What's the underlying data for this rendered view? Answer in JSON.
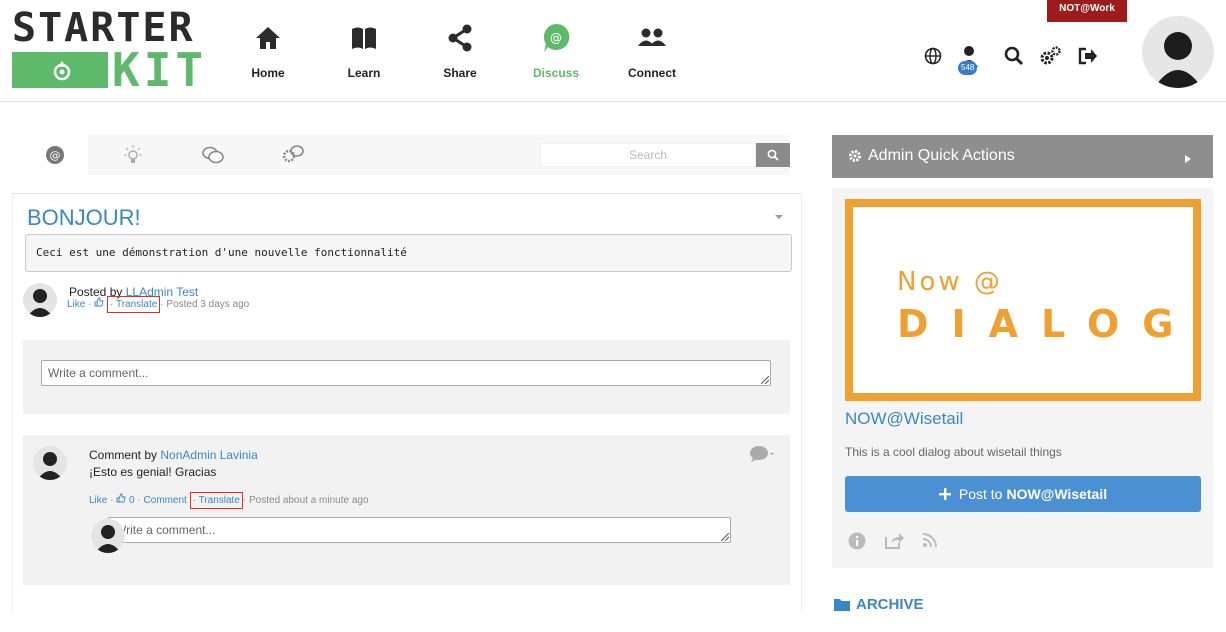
{
  "logo": {
    "line1": "STARTER",
    "line2": "KIT"
  },
  "nav": [
    {
      "label": "Home",
      "icon": "home-icon"
    },
    {
      "label": "Learn",
      "icon": "book-icon"
    },
    {
      "label": "Share",
      "icon": "share-icon"
    },
    {
      "label": "Discuss",
      "icon": "at-chat-icon",
      "active": true
    },
    {
      "label": "Connect",
      "icon": "users-icon"
    }
  ],
  "header": {
    "not_at_work": "NOT@Work",
    "notification_count": "548",
    "icons": [
      "globe-icon",
      "user-badge-icon",
      "search-icon",
      "gears-icon",
      "logout-icon",
      "user-avatar"
    ]
  },
  "discuss": {
    "tabs": [
      "at-icon",
      "lightbulb-icon",
      "chat-bubbles-icon",
      "gear-chat-icon"
    ],
    "search_placeholder": "Search"
  },
  "post": {
    "title": "BONJOUR!",
    "body": "Ceci est une démonstration d'une nouvelle fonctionnalité",
    "posted_by_prefix": "Posted by",
    "author": "LLAdmin Test",
    "like": "Like",
    "translate": "Translate",
    "time": "Posted 3 days ago",
    "comment_placeholder": "Write a comment..."
  },
  "comment": {
    "prefix": "Comment by",
    "author": "NonAdmin Lavinia",
    "text": "¡Esto es genial! Gracias",
    "like": "Like",
    "like_count": "0",
    "comment_link": "Comment",
    "translate": "Translate",
    "time": "Posted about a minute ago",
    "reply_placeholder": "Write a comment..."
  },
  "sidebar": {
    "quick_actions": "Admin Quick Actions",
    "dialog_image": {
      "line1": "Now @",
      "line2": "DIALOG"
    },
    "dialog_title": "NOW@Wisetail",
    "dialog_desc": "This is a cool dialog about wisetail things",
    "post_button_prefix": "Post to",
    "post_button_target": "NOW@Wisetail",
    "archive": "ARCHIVE"
  },
  "colors": {
    "brand_green": "#5fb96b",
    "link_blue": "#3a87c8",
    "accent_orange": "#f0a030",
    "alert_red": "#9e1b1b",
    "button_blue": "#4a90d2"
  }
}
